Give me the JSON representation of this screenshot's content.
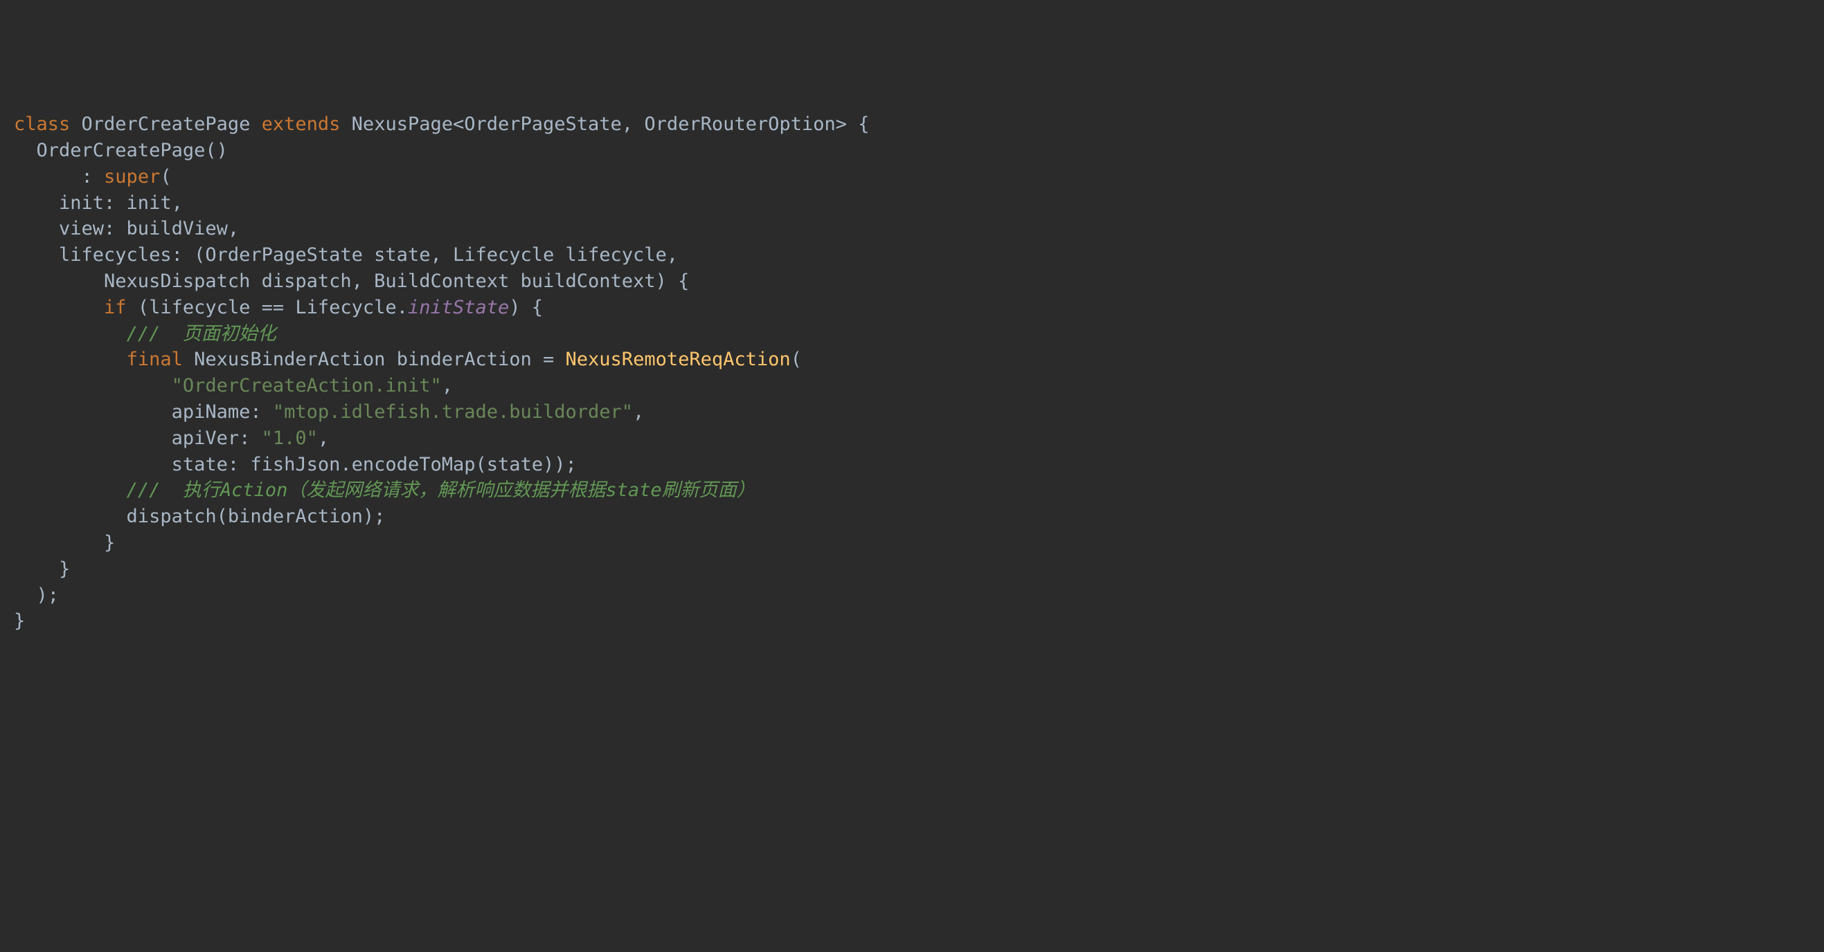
{
  "code": {
    "l1": {
      "kw_class": "class",
      "class_name": " OrderCreatePage ",
      "kw_extends": "extends",
      "base": " NexusPage<OrderPageState, OrderRouterOption> {"
    },
    "l2": "  OrderCreatePage()",
    "l3": {
      "prefix": "      : ",
      "kw_super": "super",
      "suffix": "("
    },
    "l4": "    init: init,",
    "l5": "    view: buildView,",
    "l6": "    lifecycles: (OrderPageState state, Lifecycle lifecycle,",
    "l7": "        NexusDispatch dispatch, BuildContext buildContext) {",
    "l8": {
      "indent": "        ",
      "kw_if": "if",
      "cond_open": " (lifecycle == Lifecycle.",
      "prop": "initState",
      "cond_close": ") {"
    },
    "l9": {
      "indent": "          ",
      "comment": "///  页面初始化"
    },
    "l10": {
      "indent": "          ",
      "kw_final": "final",
      "decl": " NexusBinderAction binderAction = ",
      "ctor": "NexusRemoteReqAction",
      "open": "("
    },
    "l11": {
      "indent": "              ",
      "str": "\"OrderCreateAction.init\"",
      "comma": ","
    },
    "l12": {
      "indent": "              apiName: ",
      "str": "\"mtop.idlefish.trade.buildorder\"",
      "comma": ","
    },
    "l13": {
      "indent": "              apiVer: ",
      "str": "\"1.0\"",
      "comma": ","
    },
    "l14": "              state: fishJson.encodeToMap(state));",
    "l15": {
      "indent": "          ",
      "comment": "///  执行Action（发起网络请求，解析响应数据并根据state刷新页面）"
    },
    "l16": "          dispatch(binderAction);",
    "l17": "        }",
    "l18": "    }",
    "l19": "  );",
    "l20": "}"
  }
}
